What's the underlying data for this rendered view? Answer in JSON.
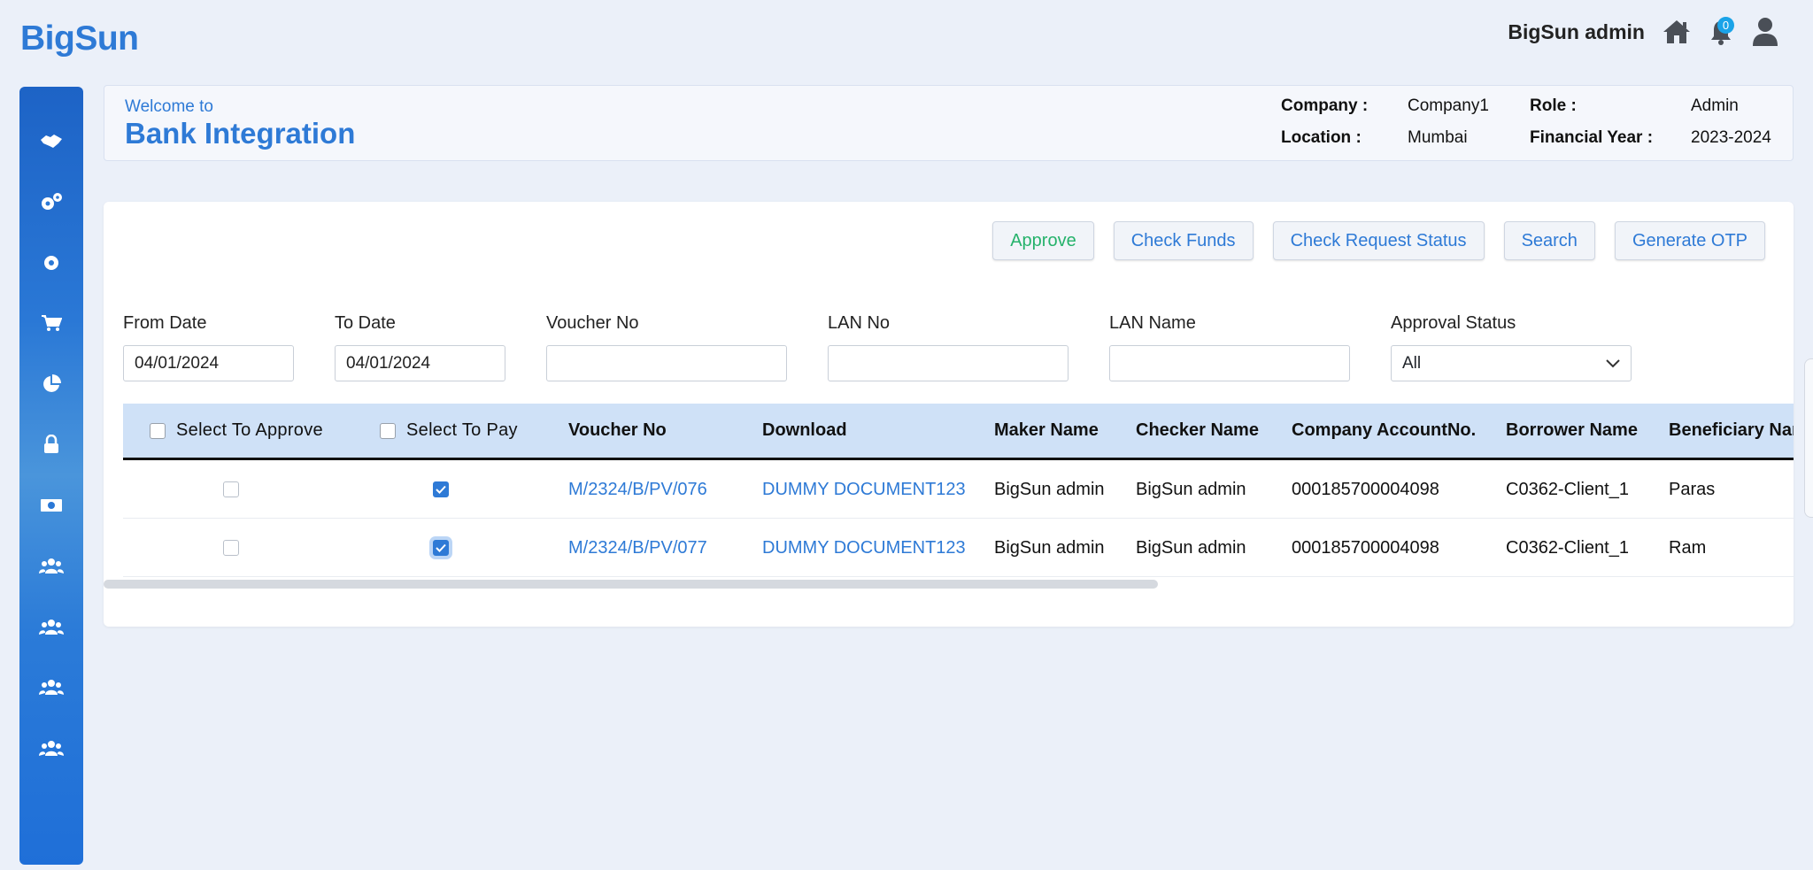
{
  "header": {
    "logo": "BigSun",
    "username": "BigSun admin",
    "notification_count": "0",
    "icons": [
      "home-icon",
      "bell-icon",
      "user-icon"
    ]
  },
  "sidebar": {
    "items": [
      {
        "icon": "handshake-icon"
      },
      {
        "icon": "cogs-icon"
      },
      {
        "icon": "gear-icon"
      },
      {
        "icon": "cart-icon"
      },
      {
        "icon": "pie-chart-icon"
      },
      {
        "icon": "lock-icon"
      },
      {
        "icon": "money-icon"
      },
      {
        "icon": "users-icon"
      },
      {
        "icon": "users-icon"
      },
      {
        "icon": "users-icon"
      },
      {
        "icon": "users-icon"
      }
    ]
  },
  "welcome": {
    "welcome_to": "Welcome to",
    "title": "Bank Integration",
    "company_label": "Company :",
    "company_value": "Company1",
    "location_label": "Location :",
    "location_value": "Mumbai",
    "role_label": "Role :",
    "role_value": "Admin",
    "fy_label": "Financial Year :",
    "fy_value": "2023-2024"
  },
  "toolbar": {
    "approve": "Approve",
    "check_funds": "Check Funds",
    "check_request_status": "Check Request Status",
    "search": "Search",
    "generate_otp": "Generate OTP"
  },
  "filters": {
    "from_date_label": "From Date",
    "from_date_value": "04/01/2024",
    "to_date_label": "To Date",
    "to_date_value": "04/01/2024",
    "voucher_no_label": "Voucher No",
    "voucher_no_value": "",
    "lan_no_label": "LAN No",
    "lan_no_value": "",
    "lan_name_label": "LAN Name",
    "lan_name_value": "",
    "approval_status_label": "Approval Status",
    "approval_status_value": "All"
  },
  "table": {
    "headers": {
      "select_approve": "Select To Approve",
      "select_pay": "Select To Pay",
      "voucher_no": "Voucher No",
      "download": "Download",
      "maker_name": "Maker Name",
      "checker_name": "Checker Name",
      "company_account": "Company AccountNo.",
      "borrower_name": "Borrower Name",
      "beneficiary_name": "Beneficiary Name"
    },
    "rows": [
      {
        "approve_checked": false,
        "pay_checked": true,
        "voucher_no": "M/2324/B/PV/076",
        "download": "DUMMY DOCUMENT123",
        "maker_name": "BigSun admin",
        "checker_name": "BigSun admin",
        "company_account": "000185700004098",
        "borrower_name": "C0362-Client_1",
        "beneficiary_name": "Paras"
      },
      {
        "approve_checked": false,
        "pay_checked": true,
        "voucher_no": "M/2324/B/PV/077",
        "download": "DUMMY DOCUMENT123",
        "maker_name": "BigSun admin",
        "checker_name": "BigSun admin",
        "company_account": "000185700004098",
        "borrower_name": "C0362-Client_1",
        "beneficiary_name": "Ram"
      }
    ]
  }
}
